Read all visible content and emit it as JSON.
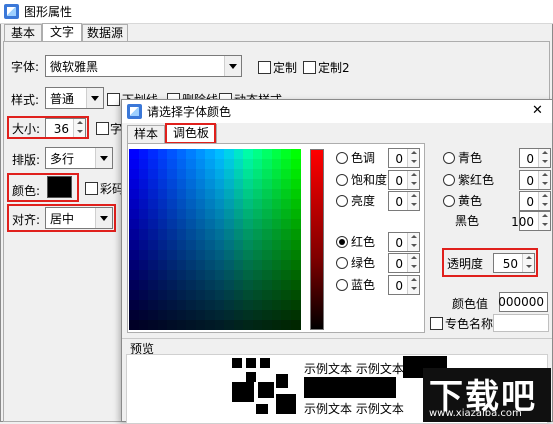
{
  "main_window": {
    "title": "图形属性",
    "tabs": [
      {
        "label": "基本",
        "active": false
      },
      {
        "label": "文字",
        "active": true
      },
      {
        "label": "数据源",
        "active": false
      }
    ]
  },
  "text_tab": {
    "font_label": "字体:",
    "font_value": "微软雅黑",
    "custom1_label": "定制",
    "custom2_label": "定制2",
    "style_label": "样式:",
    "style_value": "普通",
    "underline_label": "下划线",
    "strikethrough_label": "删除线",
    "dynamic_style_label": "动态样式",
    "size_label": "大小:",
    "size_value": "36",
    "size_extra_label": "字",
    "layout_label": "排版:",
    "layout_value": "多行",
    "color_label": "颜色:",
    "color_value": "#000000",
    "colorful_label": "彩码",
    "align_label": "对齐:",
    "align_value": "居中"
  },
  "color_dialog": {
    "title": "请选择字体颜色",
    "close_glyph": "✕",
    "tabs": [
      {
        "label": "样本",
        "active": false
      },
      {
        "label": "调色板",
        "active": true
      }
    ],
    "hsb": [
      {
        "label": "色调",
        "value": "0",
        "selected": false
      },
      {
        "label": "饱和度",
        "value": "0",
        "selected": false
      },
      {
        "label": "亮度",
        "value": "0",
        "selected": false
      }
    ],
    "rgb": [
      {
        "label": "红色",
        "value": "0",
        "selected": true
      },
      {
        "label": "绿色",
        "value": "0",
        "selected": false
      },
      {
        "label": "蓝色",
        "value": "0",
        "selected": false
      }
    ],
    "cmyk": [
      {
        "label": "青色",
        "value": "0"
      },
      {
        "label": "紫红色",
        "value": "0"
      },
      {
        "label": "黄色",
        "value": "0"
      },
      {
        "label": "黑色",
        "value": "100"
      }
    ],
    "transparency_label": "透明度",
    "transparency_value": "50",
    "color_value_label": "颜色值",
    "color_value": "000000",
    "spot_color_label": "专色名称",
    "spot_color_value": "",
    "preview_label": "预览",
    "preview_text": "示例文本 示例文本",
    "preview_text_bottom": "示例文本 示例文本"
  },
  "watermark": {
    "main_text": "下载吧",
    "url": "www.xiazaiba.com"
  },
  "colors": {
    "highlight_red": "#e0201c",
    "selected_font_color": "#000000"
  }
}
